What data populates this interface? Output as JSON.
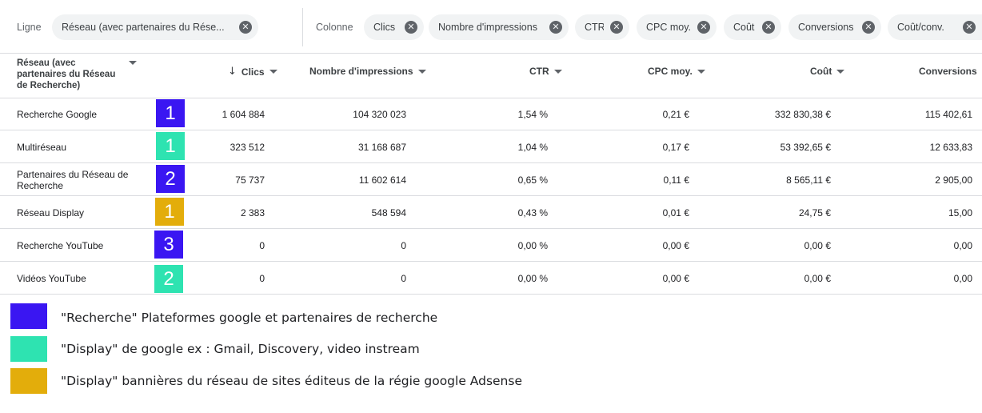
{
  "filters": {
    "row_label": "Ligne",
    "row_chip": "Réseau (avec partenaires du Rése...",
    "col_label": "Colonne",
    "col_chips": [
      "Clics",
      "Nombre d'impressions",
      "CTR",
      "CPC moy.",
      "Coût",
      "Conversions",
      "Coût/conv."
    ]
  },
  "table": {
    "headers": {
      "network": "Réseau (avec partenaires du Réseau de Recherche)",
      "clicks": "Clics",
      "impressions": "Nombre d'impressions",
      "ctr": "CTR",
      "cpc": "CPC moy.",
      "cost": "Coût",
      "conversions": "Conversions"
    },
    "sort_icon": "arrow-down-icon",
    "rows": [
      {
        "name": "Recherche Google",
        "badge": "1",
        "clicks": "1 604 884",
        "impressions": "104 320 023",
        "ctr": "1,54 %",
        "cpc": "0,21 €",
        "cost": "332 830,38 €",
        "conversions": "115 402,61"
      },
      {
        "name": "Multiréseau",
        "badge": "1",
        "clicks": "323 512",
        "impressions": "31 168 687",
        "ctr": "1,04 %",
        "cpc": "0,17 €",
        "cost": "53 392,65 €",
        "conversions": "12 633,83"
      },
      {
        "name": "Partenaires du Réseau de Recherche",
        "badge": "2",
        "clicks": "75 737",
        "impressions": "11 602 614",
        "ctr": "0,65 %",
        "cpc": "0,11 €",
        "cost": "8 565,11 €",
        "conversions": "2 905,00"
      },
      {
        "name": "Réseau Display",
        "badge": "1",
        "clicks": "2 383",
        "impressions": "548 594",
        "ctr": "0,43 %",
        "cpc": "0,01 €",
        "cost": "24,75 €",
        "conversions": "15,00"
      },
      {
        "name": "Recherche YouTube",
        "badge": "3",
        "clicks": "0",
        "impressions": "0",
        "ctr": "0,00 %",
        "cpc": "0,00 €",
        "cost": "0,00 €",
        "conversions": "0,00"
      },
      {
        "name": "Vidéos YouTube",
        "badge": "2",
        "clicks": "0",
        "impressions": "0",
        "ctr": "0,00 %",
        "cpc": "0,00 €",
        "cost": "0,00 €",
        "conversions": "0,00"
      }
    ]
  },
  "legend": {
    "items": [
      {
        "text": "\"Recherche\" Plateformes google et partenaires de recherche"
      },
      {
        "text": "\"Display\" de google ex : Gmail,  Discovery, video instream"
      },
      {
        "text": "\"Display\" bannières du réseau de sites éditeus de la régie google Adsense"
      }
    ]
  },
  "colors": {
    "search_blue": "#3a16f2",
    "display_teal": "#2ee3b1",
    "adsense_gold": "#e3ad0b"
  }
}
